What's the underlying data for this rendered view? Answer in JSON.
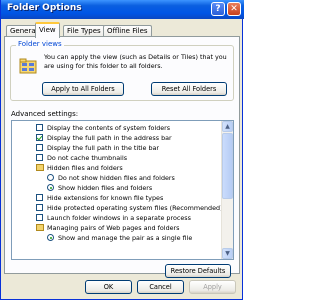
{
  "window": {
    "title": "Folder Options",
    "help_glyph": "?",
    "close_glyph": "✕"
  },
  "tabs": [
    {
      "label": "General"
    },
    {
      "label": "View"
    },
    {
      "label": "File Types"
    },
    {
      "label": "Offline Files"
    }
  ],
  "folder_views": {
    "legend": "Folder views",
    "description": "You can apply the view (such as Details or Tiles) that you are using for this folder to all folders.",
    "apply_label": "Apply to All Folders",
    "reset_label": "Reset All Folders"
  },
  "advanced": {
    "label": "Advanced settings:",
    "items": [
      {
        "kind": "checkbox",
        "checked": false,
        "label": "Display the contents of system folders"
      },
      {
        "kind": "checkbox",
        "checked": true,
        "label": "Display the full path in the address bar"
      },
      {
        "kind": "checkbox",
        "checked": false,
        "label": "Display the full path in the title bar"
      },
      {
        "kind": "checkbox",
        "checked": false,
        "label": "Do not cache thumbnails"
      },
      {
        "kind": "folder",
        "label": "Hidden files and folders"
      },
      {
        "kind": "radio",
        "checked": false,
        "label": "Do not show hidden files and folders"
      },
      {
        "kind": "radio",
        "checked": true,
        "label": "Show hidden files and folders"
      },
      {
        "kind": "checkbox",
        "checked": false,
        "label": "Hide extensions for known file types"
      },
      {
        "kind": "checkbox",
        "checked": false,
        "label": "Hide protected operating system files (Recommended)"
      },
      {
        "kind": "checkbox",
        "checked": false,
        "label": "Launch folder windows in a separate process"
      },
      {
        "kind": "folder",
        "label": "Managing pairs of Web pages and folders"
      },
      {
        "kind": "radio",
        "checked": true,
        "label": "Show and manage the pair as a single file"
      }
    ],
    "scroll_up_glyph": "▲",
    "scroll_down_glyph": "▼"
  },
  "restore_defaults_label": "Restore Defaults",
  "footer": {
    "ok_label": "OK",
    "cancel_label": "Cancel",
    "apply_label": "Apply"
  }
}
